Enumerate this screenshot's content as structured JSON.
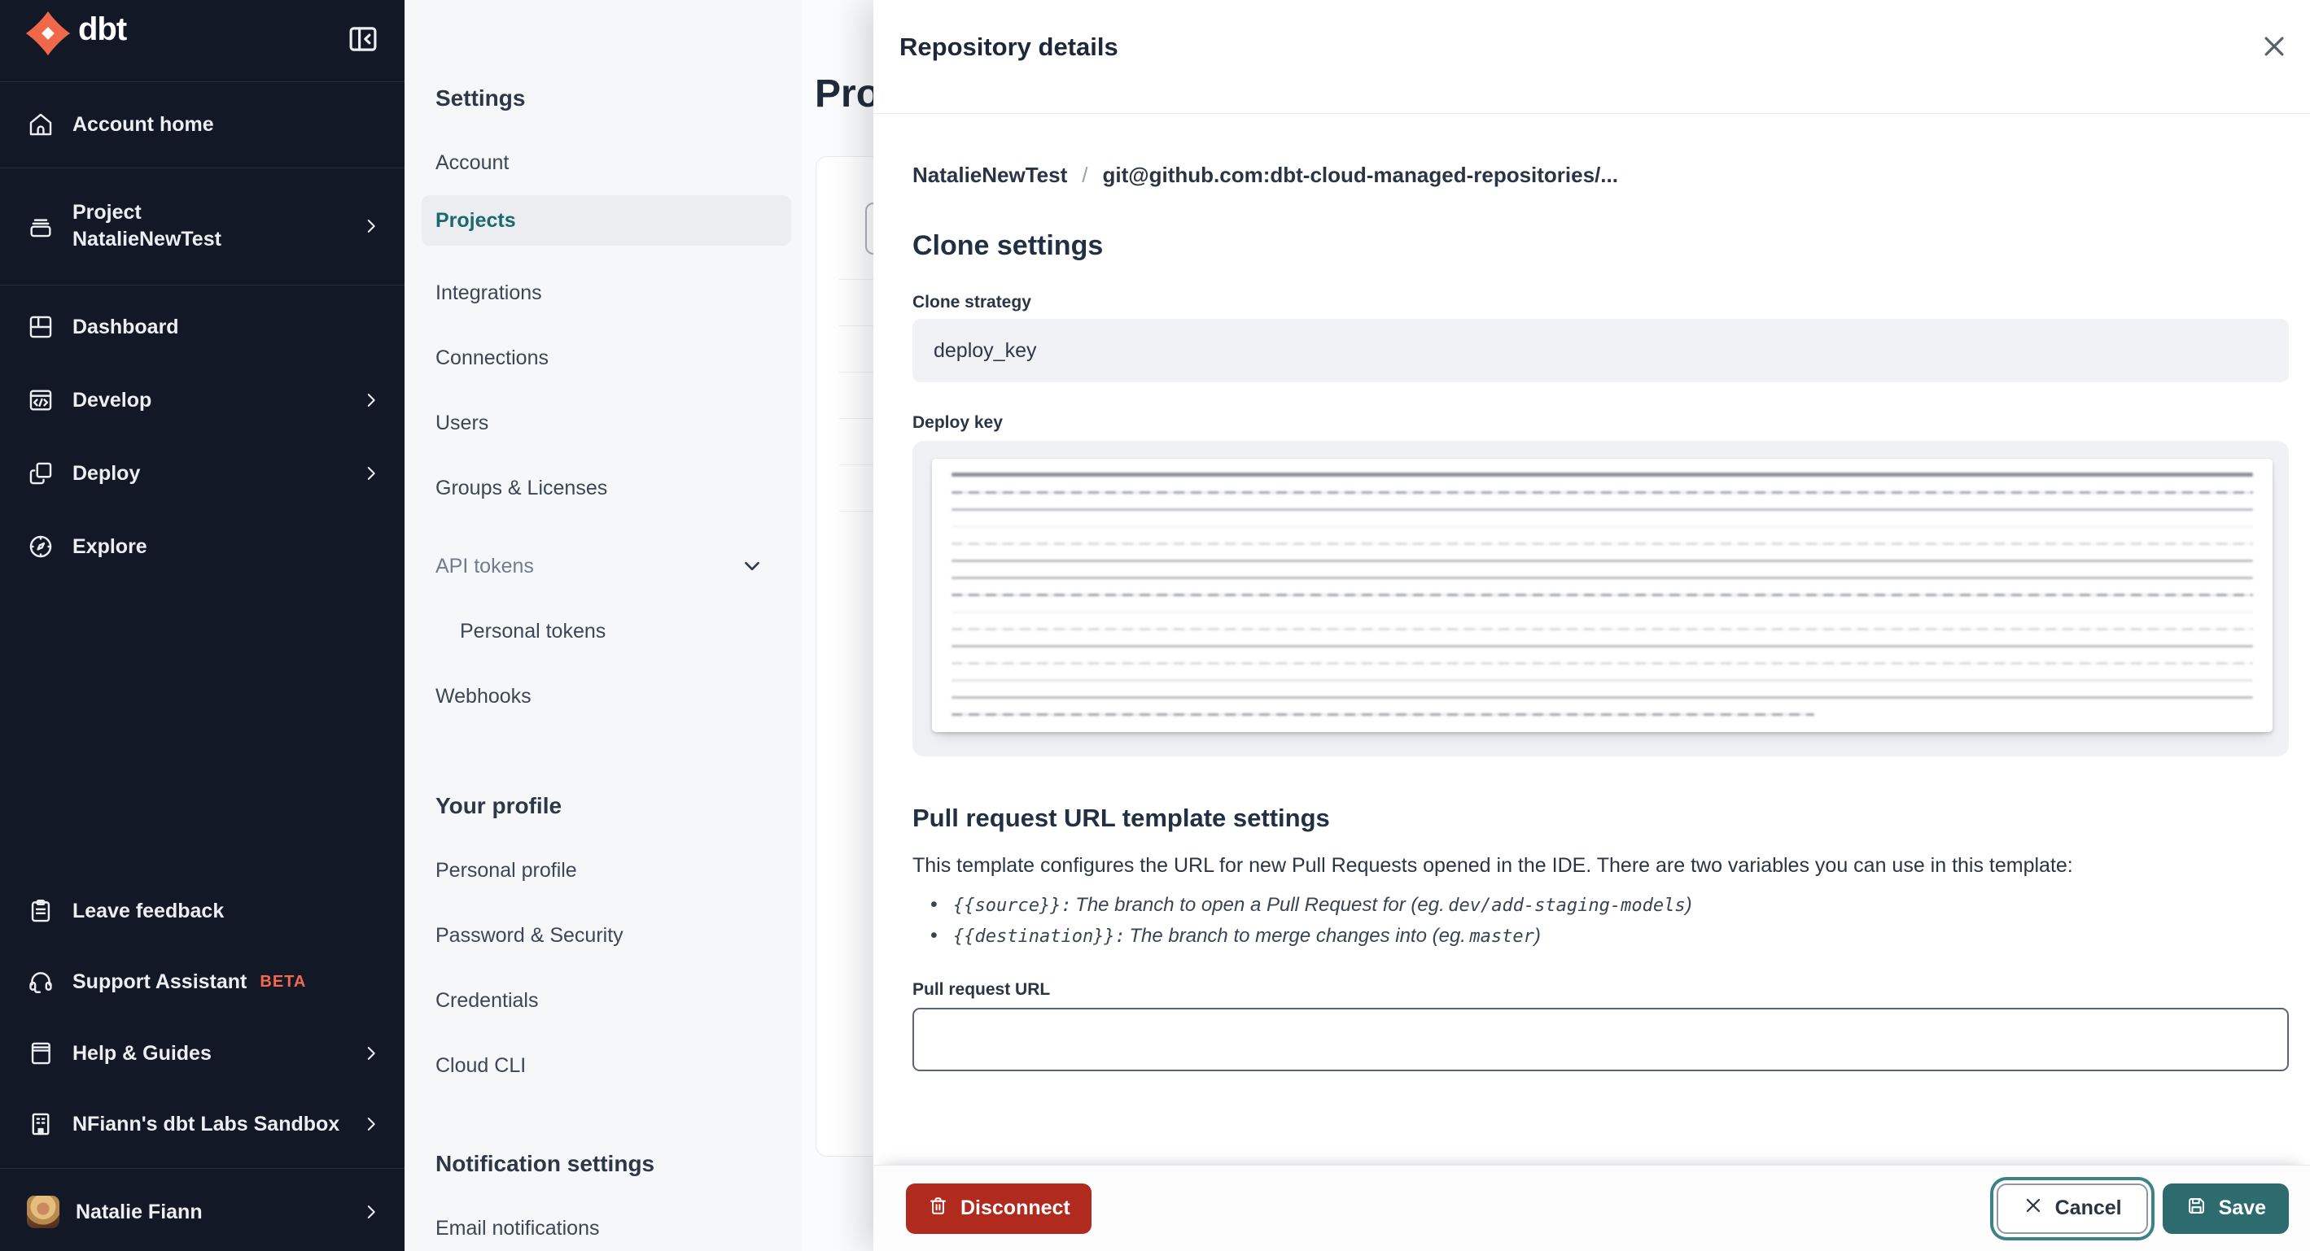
{
  "brand": {
    "name": "dbt",
    "logo_color": "#f0684a"
  },
  "sidebar": {
    "collapse_icon": "panel-collapse-left",
    "account_home": "Account home",
    "project": {
      "line1": "Project",
      "line2": "NatalieNewTest"
    },
    "dashboard": "Dashboard",
    "develop": "Develop",
    "deploy": "Deploy",
    "explore": "Explore",
    "leave_feedback": "Leave feedback",
    "support_assistant": "Support Assistant",
    "support_badge": "BETA",
    "help_guides": "Help & Guides",
    "sandbox": "NFiann's dbt Labs Sandbox",
    "user": "Natalie Fiann"
  },
  "settings_nav": {
    "header": "Settings",
    "account": "Account",
    "projects": "Projects",
    "integrations": "Integrations",
    "connections": "Connections",
    "users": "Users",
    "groups": "Groups & Licenses",
    "api_tokens": "API tokens",
    "personal_tokens": "Personal tokens",
    "webhooks": "Webhooks",
    "your_profile_header": "Your profile",
    "personal_profile": "Personal profile",
    "password_security": "Password & Security",
    "credentials": "Credentials",
    "cloud_cli": "Cloud CLI",
    "notification_header": "Notification settings",
    "email_notifications": "Email notifications"
  },
  "main": {
    "title": "Projects"
  },
  "drawer": {
    "title": "Repository details",
    "breadcrumb": {
      "project": "NatalieNewTest",
      "separator": "/",
      "repo": "git@github.com:dbt-cloud-managed-repositories/..."
    },
    "clone_settings": {
      "heading": "Clone settings",
      "strategy_label": "Clone strategy",
      "strategy_value": "deploy_key",
      "deploy_key_label": "Deploy key"
    },
    "pr_template": {
      "heading": "Pull request URL template settings",
      "description": "This template configures the URL for new Pull Requests opened in the IDE. There are two variables you can use in this template:",
      "bullets": [
        {
          "code": "{{source}}:",
          "text": "The branch to open a Pull Request for (eg.",
          "example": "dev/add-staging-models",
          "close": ")"
        },
        {
          "code": "{{destination}}:",
          "text": "The branch to merge changes into (eg.",
          "example": "master",
          "close": ")"
        }
      ],
      "url_label": "Pull request URL",
      "url_value": ""
    },
    "footer": {
      "disconnect": "Disconnect",
      "cancel": "Cancel",
      "save": "Save"
    }
  },
  "colors": {
    "accent_orange": "#f26a4b",
    "teal_selected": "#19696d",
    "save_teal": "#2e6b6f",
    "disconnect_red": "#b02a1e",
    "sidebar_bg": "#131826"
  }
}
